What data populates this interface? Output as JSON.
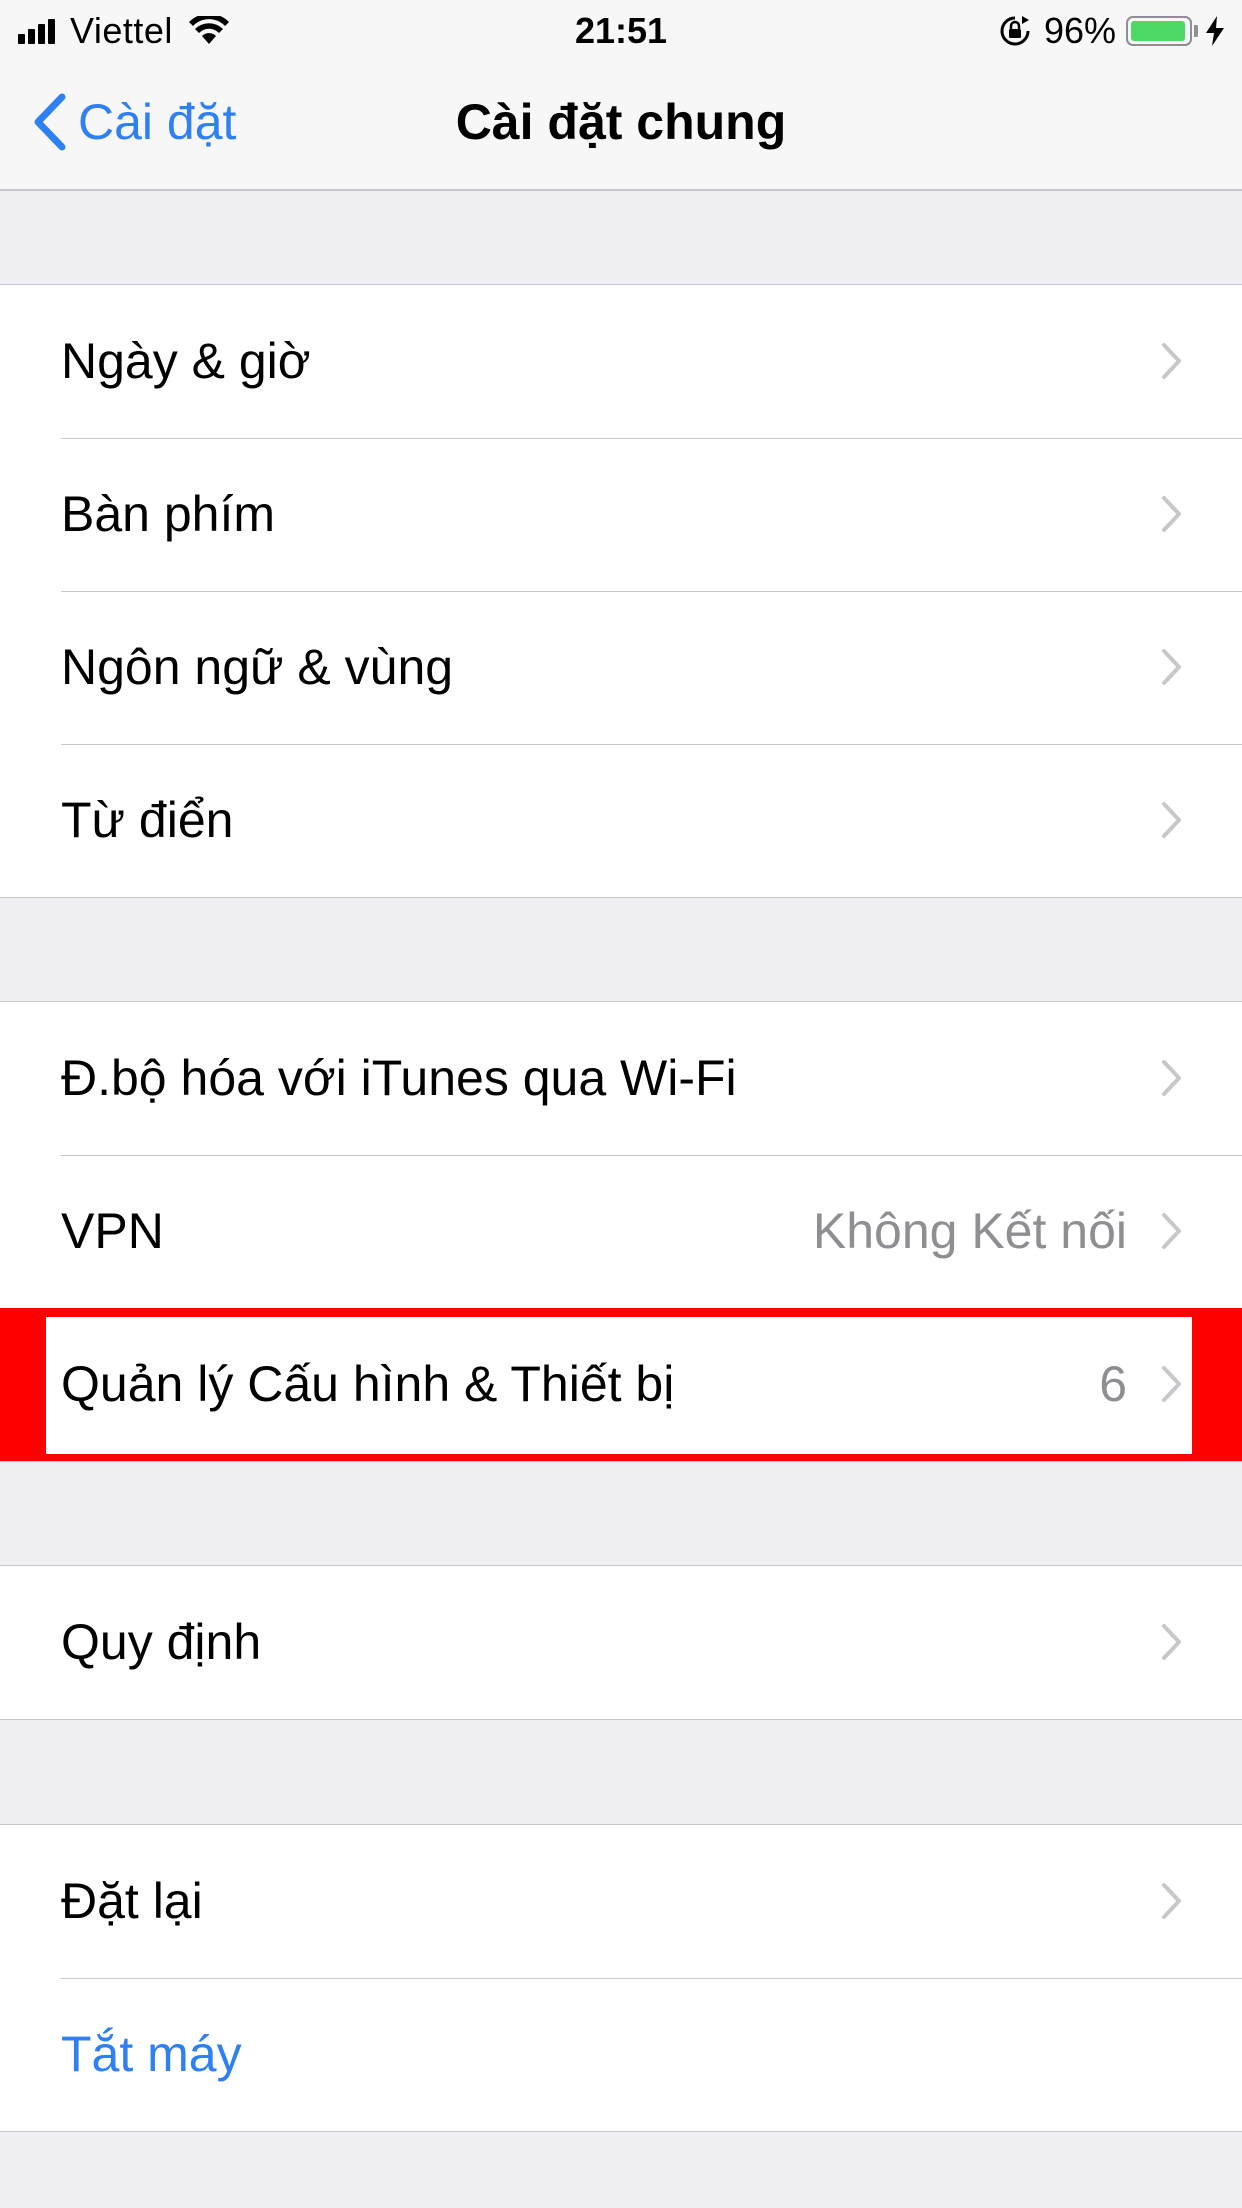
{
  "status_bar": {
    "carrier": "Viettel",
    "time": "21:51",
    "battery_percent": "96%",
    "battery_level": 0.96,
    "icons": [
      "signal-bars-icon",
      "wifi-icon",
      "orientation-lock-icon",
      "battery-icon",
      "charging-bolt-icon"
    ]
  },
  "nav": {
    "back_label": "Cài đặt",
    "title": "Cài đặt chung"
  },
  "groups": [
    {
      "rows": [
        {
          "label": "Ngày & giờ"
        },
        {
          "label": "Bàn phím"
        },
        {
          "label": "Ngôn ngữ & vùng"
        },
        {
          "label": "Từ điển"
        }
      ]
    },
    {
      "rows": [
        {
          "label": "Đ.bộ hóa với iTunes qua Wi-Fi"
        },
        {
          "label": "VPN",
          "value": "Không Kết nối"
        },
        {
          "label": "Quản lý Cấu hình & Thiết bị",
          "value": "6",
          "highlighted": true
        }
      ]
    },
    {
      "rows": [
        {
          "label": "Quy định"
        }
      ]
    },
    {
      "rows": [
        {
          "label": "Đặt lại"
        },
        {
          "label": "Tắt máy",
          "action": true
        }
      ]
    }
  ],
  "colors": {
    "accent": "#2f7ff5",
    "background": "#efeff4",
    "highlight": "#ff0000",
    "battery": "#4cd964"
  }
}
